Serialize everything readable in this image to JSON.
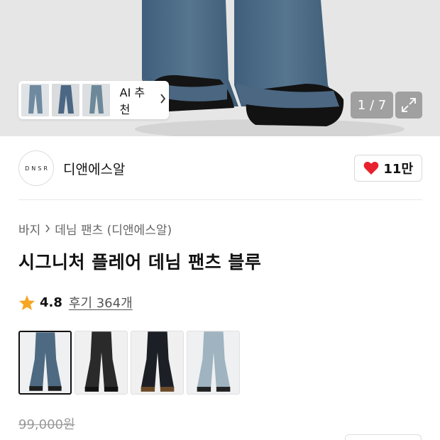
{
  "hero": {
    "ai_recommend_label": "AI 추천",
    "pager_text": "1 / 7",
    "icons": [
      "chevron-right-icon",
      "expand-icon"
    ]
  },
  "brand": {
    "logo_text": "DNSR",
    "name": "디앤에스알",
    "like_count": "11만",
    "like_color": "#e8212e"
  },
  "product": {
    "breadcrumb": [
      "바지",
      "데님 팬츠 (디앤에스알)"
    ],
    "title": "시그니처 플레어 데님 팬츠 블루",
    "rating": "4.8",
    "reviews": "후기 364개",
    "star_color": "#f5a623",
    "original_price": "99,000원"
  },
  "colors": {
    "options": [
      {
        "name": "blue",
        "tone": "#4d6a82",
        "selected": true
      },
      {
        "name": "black-washed",
        "tone": "#2a2a2a",
        "selected": false
      },
      {
        "name": "black",
        "tone": "#1c1f26",
        "selected": false
      },
      {
        "name": "light-blue",
        "tone": "#9fb3c0",
        "selected": false
      }
    ]
  }
}
